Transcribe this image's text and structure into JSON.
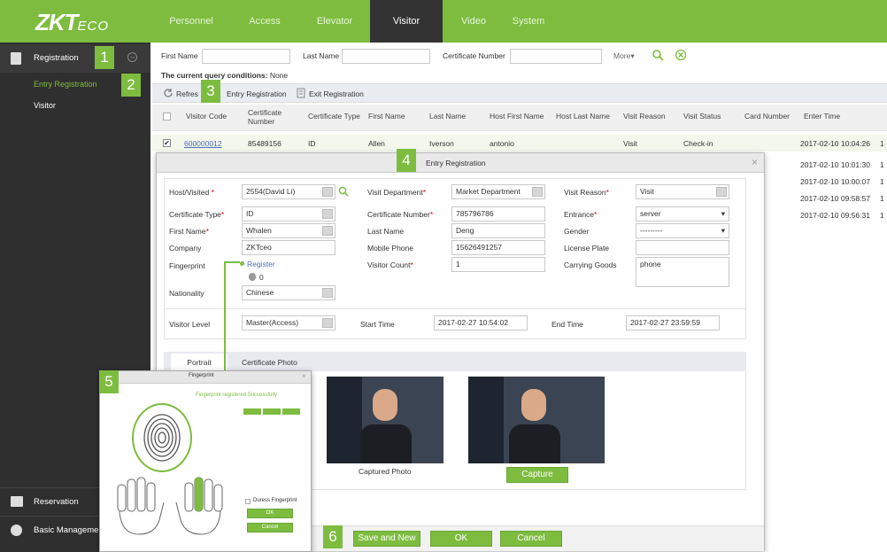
{
  "brand": {
    "logo_main": "ZKT",
    "logo_sub": "ECO"
  },
  "nav": {
    "tabs": [
      "Personnel",
      "Access",
      "Elevator",
      "Visitor",
      "Video",
      "System"
    ]
  },
  "sidebar": {
    "registration": "Registration",
    "entry_registration": "Entry Registration",
    "visitor": "Visitor",
    "reservation": "Reservation",
    "basic_management": "Basic Managemen"
  },
  "callouts": [
    "1",
    "2",
    "3",
    "4",
    "5",
    "6"
  ],
  "filters": {
    "first_name": "First Name",
    "last_name": "Last Name",
    "certificate_number": "Certificate Number",
    "more": "More▾",
    "query_label": "The current query conditions:",
    "query_value": "None"
  },
  "toolbar": {
    "refresh": "Refres",
    "entry_registration": "Entry Registration",
    "exit_registration": "Exit Registration"
  },
  "grid": {
    "columns": [
      "Visitor Code",
      "Certificate Number",
      "Certificate Type",
      "First Name",
      "Last Name",
      "Host First Name",
      "Host Last Name",
      "Visit Reason",
      "Visit Status",
      "Card Number",
      "Enter Time"
    ],
    "rows": [
      {
        "code": "600000012",
        "cert_no": "85489156",
        "cert_type": "ID",
        "first": "Allen",
        "last": "Iverson",
        "host_first": "antonio",
        "host_last": "",
        "reason": "Visit",
        "status": "Check-in",
        "card": "",
        "enter": "2017-02-10 10:04:26"
      }
    ],
    "more_times": [
      "2017-02-10 10:01:30",
      "2017-02-10 10:00:07",
      "2017-02-10 09:58:57",
      "2017-02-10 09:56:31"
    ],
    "trailing": "1"
  },
  "dialog": {
    "title": "Entry Registration",
    "close": "×",
    "host_visited": {
      "label": "Host/Visited",
      "value": "2554(David Li)"
    },
    "visit_department": {
      "label": "Visit Department",
      "value": "Market Department"
    },
    "visit_reason": {
      "label": "Visit Reason",
      "value": "Visit"
    },
    "certificate_type": {
      "label": "Certificate Type",
      "value": "ID"
    },
    "certificate_number": {
      "label": "Certificate Number",
      "value": "785796786"
    },
    "entrance": {
      "label": "Entrance",
      "value": "server"
    },
    "first_name": {
      "label": "First Name",
      "value": "Whalen"
    },
    "last_name": {
      "label": "Last Name",
      "value": "Deng"
    },
    "gender": {
      "label": "Gender",
      "value": "---------"
    },
    "company": {
      "label": "Company",
      "value": "ZKTceo"
    },
    "mobile_phone": {
      "label": "Mobile Phone",
      "value": "15626491257"
    },
    "license_plate": {
      "label": "License Plate",
      "value": ""
    },
    "fingerprint": {
      "label": "Fingerprint",
      "register": "Register",
      "count": "0"
    },
    "visitor_count": {
      "label": "Visitor Count",
      "value": "1"
    },
    "carrying_goods": {
      "label": "Carrying Goods",
      "value": "phone"
    },
    "nationality": {
      "label": "Nationality",
      "value": "Chinese"
    },
    "visitor_level": {
      "label": "Visitor Level",
      "value": "Master(Access)"
    },
    "start_time": {
      "label": "Start Time",
      "value": "2017-02-27 10:54:02"
    },
    "end_time": {
      "label": "End Time",
      "value": "2017-02-27 23:59:59"
    },
    "tabs": [
      "Portrait",
      "Certificate Photo"
    ],
    "captured_photo": "Captured Photo",
    "capture": "Capture",
    "save_and_new": "Save and New",
    "ok": "OK",
    "cancel": "Cancel"
  },
  "fingerprint_dialog": {
    "title": "Fingerprint",
    "success": "Fingerprint registered Successfully",
    "duress": "Duress Fingerprint",
    "ok": "OK",
    "cancel": "Cancel"
  },
  "colors": {
    "brand": "#7dbc3f",
    "sidebar": "#2f2f2f"
  }
}
